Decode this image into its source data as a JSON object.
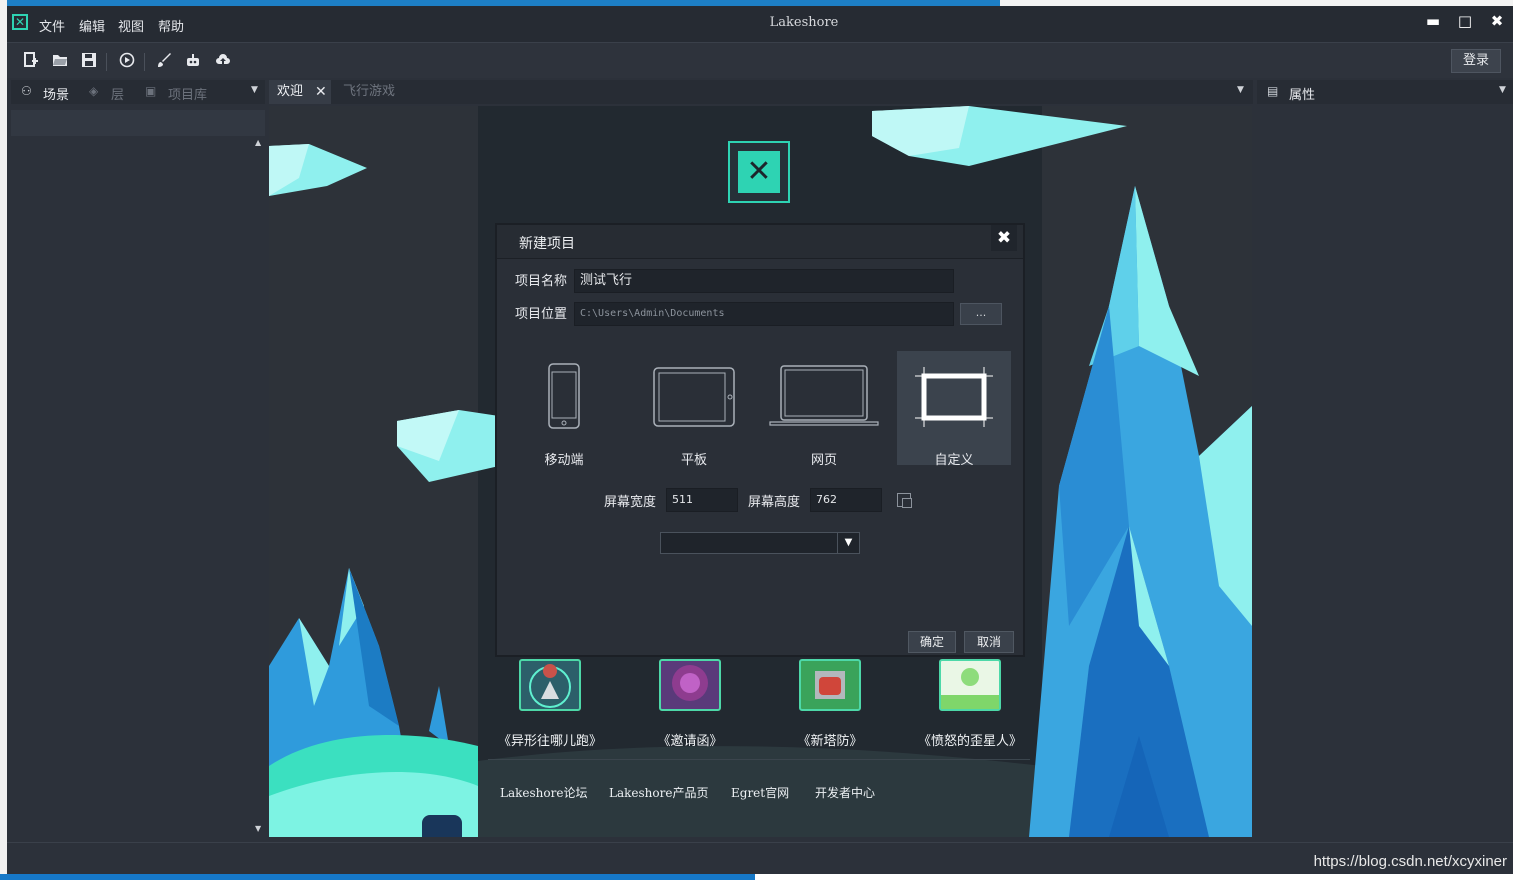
{
  "app": {
    "title": "Lakeshore",
    "logo_icon": "lakeshore-logo-icon",
    "menu": [
      "文件",
      "编辑",
      "视图",
      "帮助"
    ],
    "window_controls": {
      "minimize": "▬",
      "maximize": "□",
      "close": "✖"
    },
    "login_label": "登录"
  },
  "toolbar": {
    "icons": [
      "new-project-icon",
      "open-folder-icon",
      "save-icon",
      "play-icon",
      "brush-icon",
      "robot-icon",
      "cloud-upload-icon"
    ]
  },
  "left_panel": {
    "tabs": [
      {
        "label": "场景",
        "icon": "scene-icon",
        "active": true
      },
      {
        "label": "层",
        "icon": "layers-icon",
        "active": false
      },
      {
        "label": "项目库",
        "icon": "library-icon",
        "active": false
      }
    ]
  },
  "editor_tabs": [
    {
      "label": "欢迎",
      "active": true,
      "close": "✕"
    },
    {
      "label": "飞行游戏",
      "active": false
    }
  ],
  "right_panel": {
    "tab": {
      "label": "属性",
      "icon": "properties-icon"
    }
  },
  "welcome": {
    "games": [
      {
        "label": "《异形往哪儿跑》",
        "color": "#c8524a"
      },
      {
        "label": "《邀请函》",
        "color": "#8e3c8f"
      },
      {
        "label": "《新塔防》",
        "color": "#d0463a"
      },
      {
        "label": "《愤怒的歪星人》",
        "color": "#7fd66a"
      }
    ],
    "links": [
      "Lakeshore论坛",
      "Lakeshore产品页",
      "Egret官网",
      "开发者中心"
    ]
  },
  "dialog": {
    "title": "新建项目",
    "close": "✖",
    "name_label": "项目名称",
    "name_value": "测试飞行",
    "location_label": "项目位置",
    "location_value": "C:\\Users\\Admin\\Documents",
    "browse_label": "...",
    "devices": [
      {
        "label": "移动端",
        "icon": "mobile-icon",
        "selected": false
      },
      {
        "label": "平板",
        "icon": "tablet-icon",
        "selected": false
      },
      {
        "label": "网页",
        "icon": "laptop-icon",
        "selected": false
      },
      {
        "label": "自定义",
        "icon": "custom-size-icon",
        "selected": true
      }
    ],
    "width_label": "屏幕宽度",
    "width_value": "511",
    "height_label": "屏幕高度",
    "height_value": "762",
    "select_value": "",
    "select_arrow": "▼",
    "ok_label": "确定",
    "cancel_label": "取消"
  },
  "watermark": "https://blog.csdn.net/xcyxiner",
  "colors": {
    "accent": "#2ed3b3",
    "background": "#2c313a",
    "ice_light": "#8ff0ee",
    "ice_blue": "#2f9bdc"
  }
}
